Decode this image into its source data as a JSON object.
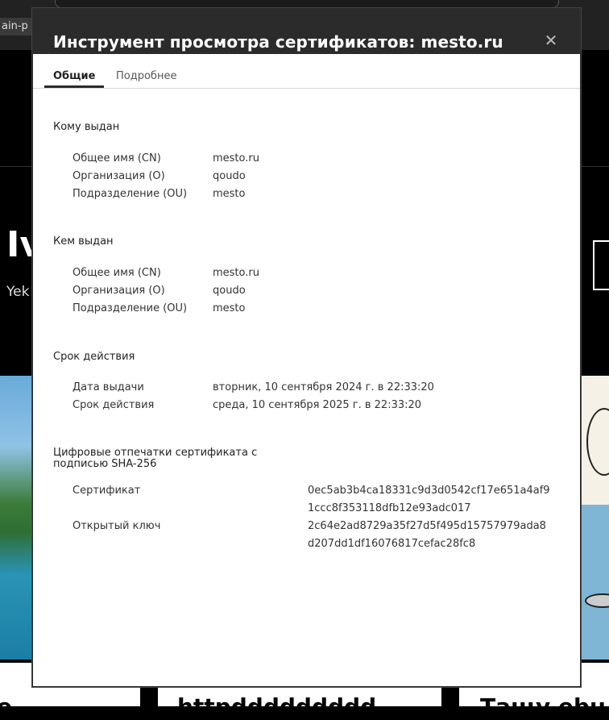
{
  "background": {
    "tab_fragment": "ain-p",
    "hero_letter": "Iv",
    "hero_sub": "Yek",
    "cards": [
      {
        "title": "e"
      },
      {
        "title": "httpddddddddd"
      },
      {
        "title": "Тащу ebu"
      }
    ]
  },
  "dialog": {
    "title": "Инструмент просмотра сертификатов: mesto.ru",
    "close_icon": "close-icon",
    "tabs": [
      {
        "label": "Общие",
        "active": true
      },
      {
        "label": "Подробнее",
        "active": false
      }
    ],
    "issued_to": {
      "heading": "Кому выдан",
      "rows": [
        {
          "label": "Общее имя (CN)",
          "value": "mesto.ru"
        },
        {
          "label": "Организация (O)",
          "value": "qoudo"
        },
        {
          "label": "Подразделение (OU)",
          "value": "mesto"
        }
      ]
    },
    "issued_by": {
      "heading": "Кем выдан",
      "rows": [
        {
          "label": "Общее имя (CN)",
          "value": "mesto.ru"
        },
        {
          "label": "Организация (O)",
          "value": "qoudo"
        },
        {
          "label": "Подразделение (OU)",
          "value": "mesto"
        }
      ]
    },
    "validity": {
      "heading": "Срок действия",
      "rows": [
        {
          "label": "Дата выдачи",
          "value": "вторник, 10 сентября 2024 г. в 22:33:20"
        },
        {
          "label": "Срок действия",
          "value": "среда, 10 сентября 2025 г. в 22:33:20"
        }
      ]
    },
    "fingerprints": {
      "heading_line1": "Цифровые отпечатки сертификата с",
      "heading_line2": "подписью SHA-256",
      "rows": [
        {
          "label": "Сертификат",
          "value_line1": "0ec5ab3b4ca18331c9d3d0542cf17e651a4af9",
          "value_line2": "1ccc8f353118dfb12e93adc017"
        },
        {
          "label": "Открытый ключ",
          "value_line1": "2c64e2ad8729a35f27d5f495d15757979ada8",
          "value_line2": "d207dd1df16076817cefac28fc8"
        }
      ]
    }
  }
}
